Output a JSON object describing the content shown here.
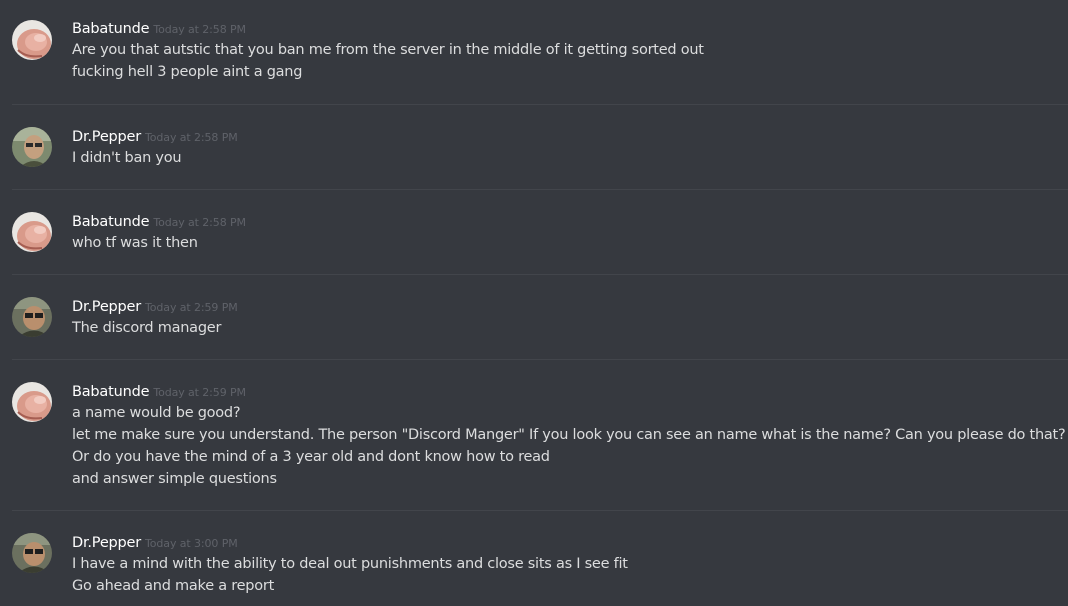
{
  "messages": [
    {
      "author": "Babatunde",
      "timestamp": "Today at 2:58 PM",
      "avatar_icon": "babatunde-avatar-icon",
      "lines": [
        "Are you that autstic that you ban me from the server in the middle of it getting sorted out",
        "fucking hell 3 people aint a gang"
      ]
    },
    {
      "author": "Dr.Pepper",
      "timestamp": "Today at 2:58 PM",
      "avatar_icon": "drpepper-avatar-icon",
      "lines": [
        "I didn't ban you"
      ]
    },
    {
      "author": "Babatunde",
      "timestamp": "Today at 2:58 PM",
      "avatar_icon": "babatunde-avatar-icon",
      "lines": [
        "who tf was it then"
      ]
    },
    {
      "author": "Dr.Pepper",
      "timestamp": "Today at 2:59 PM",
      "avatar_icon": "drpepper-avatar-icon",
      "lines": [
        "The discord manager"
      ]
    },
    {
      "author": "Babatunde",
      "timestamp": "Today at 2:59 PM",
      "avatar_icon": "babatunde-avatar-icon",
      "lines": [
        "a name would be good?",
        "let me make sure you understand. The person \"Discord Manger\" If you look you can see an name what is the name? Can you please do that?",
        "Or do you have the mind of a 3 year old and dont know how to read",
        "and answer simple questions"
      ]
    },
    {
      "author": "Dr.Pepper",
      "timestamp": "Today at 3:00 PM",
      "avatar_icon": "drpepper-avatar-icon",
      "lines": [
        "I have a mind with the ability to deal out punishments and close sits as I see fit",
        "Go ahead and make a report"
      ]
    }
  ],
  "colors": {
    "background": "#36393f",
    "username": "#ffffff",
    "timestamp": "#5f6269",
    "message_text": "#dcddde",
    "divider": "#42454b"
  }
}
